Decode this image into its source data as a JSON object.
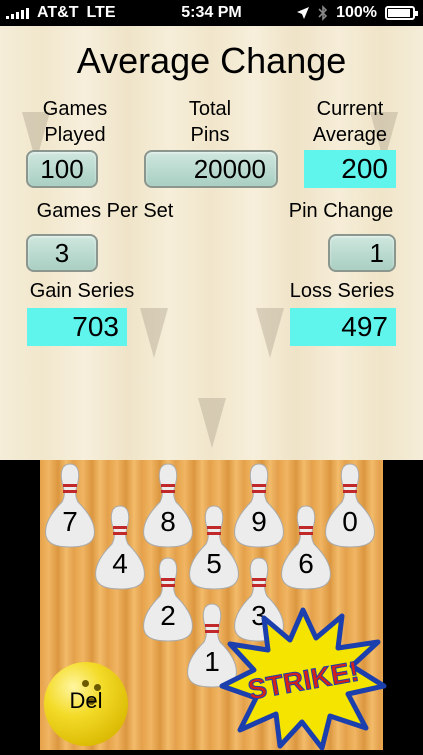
{
  "status_bar": {
    "carrier": "AT&T",
    "network": "LTE",
    "time": "5:34 PM",
    "battery": "100%",
    "battery_level": 1.0,
    "icons": [
      "signal-bars-icon",
      "location-arrow-icon",
      "bluetooth-icon",
      "battery-icon"
    ]
  },
  "title": "Average Change",
  "labels": {
    "games_played_1": "Games",
    "games_played_2": "Played",
    "total_pins_1": "Total",
    "total_pins_2": "Pins",
    "current_average_1": "Current",
    "current_average_2": "Average",
    "games_per_set": "Games Per Set",
    "pin_change": "Pin Change",
    "gain_series": "Gain Series",
    "loss_series": "Loss Series"
  },
  "fields": {
    "games_played": "100",
    "total_pins": "20000",
    "current_average": "200",
    "games_per_set": "3",
    "pin_change": "1",
    "gain_series": "703",
    "loss_series": "497"
  },
  "keypad": {
    "pins": [
      "7",
      "8",
      "9",
      "0",
      "4",
      "5",
      "6",
      "2",
      "3",
      "1"
    ],
    "del_label": "Del",
    "strike_label": "STRIKE!"
  },
  "colors": {
    "result_bg": "#5ff5ec",
    "field_bg": "#b9dace",
    "ball": "#f4dc2a",
    "strike_burst": "#f4e400",
    "strike_outline": "#1c3fae",
    "strike_text": "#d4201a"
  }
}
